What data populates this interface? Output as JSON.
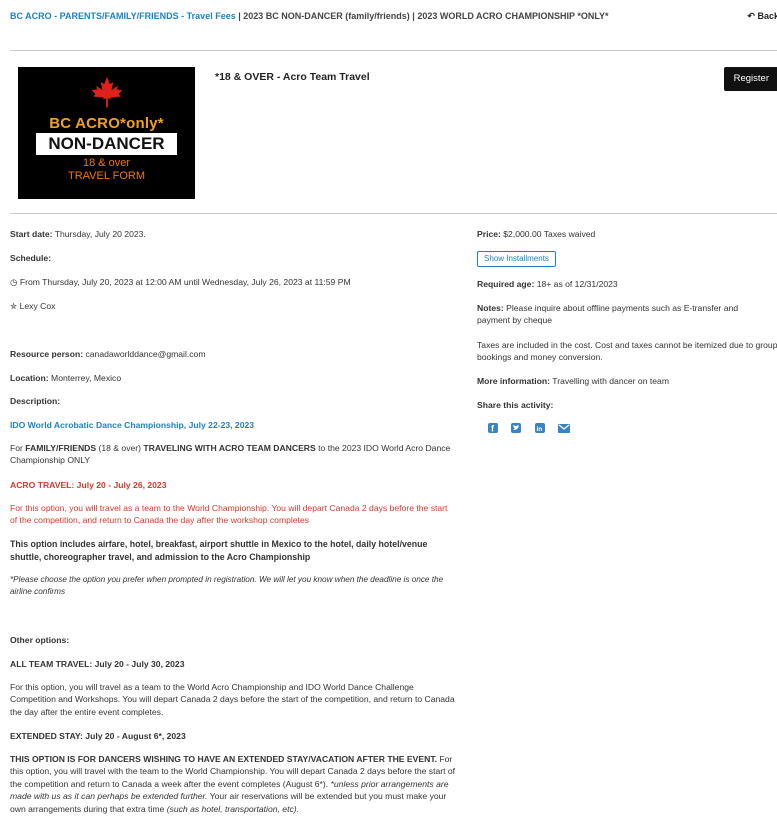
{
  "breadcrumb": {
    "part1": "BC ACRO - PARENTS/FAMILY/FRIENDS - Travel Fees",
    "sep": " | ",
    "part2": "2023 BC NON-DANCER (family/friends)",
    "part3": "2023 WORLD ACRO CHAMPIONSHIP *ONLY*"
  },
  "back_label": "Back",
  "logo": {
    "line1": "BC ACRO*only*",
    "line2": "NON-DANCER",
    "line3a": "18 & over",
    "line3b": "TRAVEL FORM"
  },
  "activity_title": "*18 & OVER - Acro Team Travel",
  "register_label": "Register",
  "left": {
    "start_label": "Start date:",
    "start_value": " Thursday, July 20 2023.",
    "schedule_label": "Schedule:",
    "schedule_text": "From Thursday, July 20, 2023 at 12:00 AM until Wednesday, July 26, 2023 at 11:59 PM",
    "instructor": "Lexy Cox",
    "resource_label": "Resource person:",
    "resource_value": " canadaworlddance@gmail.com",
    "location_label": "Location:",
    "location_value": " Monterrey, Mexico",
    "description_label": "Description:",
    "desc_heading": "IDO World Acrobatic Dance Championship, July 22-23, 2023",
    "desc_p1_a": "For ",
    "desc_p1_b": "FAMILY/FRIENDS",
    "desc_p1_c": " (18 & over) ",
    "desc_p1_d": "TRAVELING WITH ACRO TEAM DANCERS",
    "desc_p1_e": " to the 2023 IDO World Acro Dance Championship ONLY",
    "acro_travel": "ACRO TRAVEL:  July 20 - July 26, 2023",
    "acro_travel_text": "For this option, you will travel as a team to the World Championship.  You will depart Canada 2 days before the start of the competition, and return to Canada the day after the workshop completes",
    "includes": "This option includes airfare, hotel, breakfast, airport shuttle in Mexico to the hotel, daily hotel/venue shuttle, choreographer travel, and admission to the Acro Championship",
    "note": "*Please choose the option you prefer when prompted in registration.  We will let you know when the deadline is once the airline confirms",
    "other_options": "Other options:",
    "all_team": "ALL TEAM TRAVEL:  July 20 - July 30, 2023",
    "all_team_text": "For this option, you will travel as a team to the World Acro Championship and IDO World Dance Challenge Competition and Workshops.  You will depart Canada 2 days before the start of the competition, and return to Canada the day after the entire event completes.",
    "extended": "EXTENDED STAY:  July 20 - August 6*, 2023",
    "extended_bold": "THIS OPTION IS FOR DANCERS WISHING TO HAVE AN EXTENDED STAY/VACATION AFTER THE EVENT.",
    "extended_text1": " For this option, you will travel with the team to the World Championship.  You will depart Canada 2 days before the start of the competition and return to Canada a week after the event completes (August 6*).",
    "extended_it1": "  *unless prior arrangements are made with us as it can perhaps be extended further.",
    "extended_text2": "  Your air reservations will be extended but you must make your own arrangements during that extra time ",
    "extended_it2": "(such as hotel, transportation, etc)."
  },
  "right": {
    "price_label": "Price:",
    "price_value": " $2,000.00 Taxes waived",
    "show_installments": "Show Installments",
    "age_label": "Required age:",
    "age_value": " 18+ as of 12/31/2023",
    "notes_label": "Notes:",
    "notes_value": " Please inquire about offline payments such as E-transfer and payment by cheque",
    "taxes": "Taxes are included in the cost. Cost and taxes cannot be itemized due to group bookings and money conversion.",
    "more_label": "More information:",
    "more_value": " Travelling with dancer on team",
    "share_label": "Share this activity:"
  },
  "colors": {
    "link": "#1d82c4",
    "red": "#d9392b",
    "logo_red": "#e0201b",
    "logo_orange": "#f0a020"
  }
}
